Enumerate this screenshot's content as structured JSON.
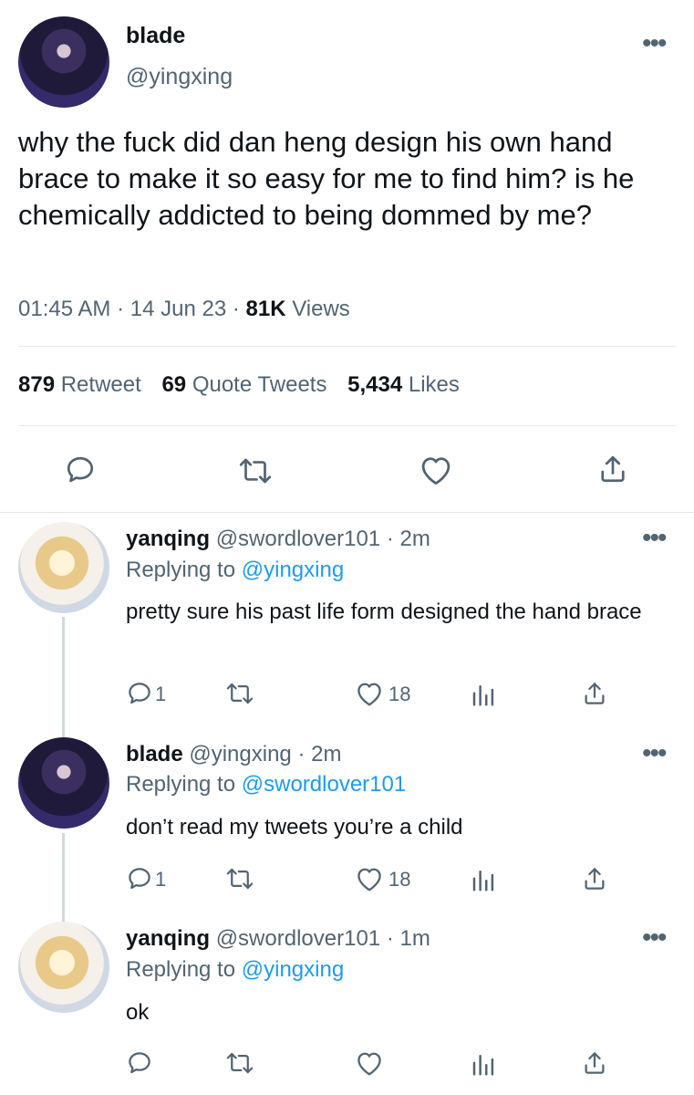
{
  "main_tweet": {
    "display_name": "blade",
    "handle": "@yingxing",
    "text": "why the fuck did dan heng design his own hand brace to make it so easy for me to find him? is he chemically addicted to being dommed by me?",
    "time": "01:45 AM",
    "date": "14 Jun 23",
    "views_count": "81K",
    "views_label": "Views",
    "sep": "·",
    "retweets_count": "879",
    "retweets_label": "Retweet",
    "quotes_count": "69",
    "quotes_label": "Quote Tweets",
    "likes_count": "5,434",
    "likes_label": "Likes"
  },
  "replies": [
    {
      "display_name": "yanqing",
      "handle": "@swordlover101",
      "age": "· 2m",
      "replying_label": "Replying to",
      "replying_to": "@yingxing",
      "text": "pretty sure his past life form designed the hand brace",
      "reply_count": "1",
      "like_count": "18"
    },
    {
      "display_name": "blade",
      "handle": "@yingxing",
      "age": "· 2m",
      "replying_label": "Replying to",
      "replying_to": "@swordlover101",
      "text": "don’t read my tweets you’re a child",
      "reply_count": "1",
      "like_count": "18"
    },
    {
      "display_name": "yanqing",
      "handle": "@swordlover101",
      "age": "· 1m",
      "replying_label": "Replying to",
      "replying_to": "@yingxing",
      "text": "ok",
      "reply_count": "",
      "like_count": ""
    }
  ],
  "icons": {
    "reply": "comment-bubble-icon",
    "retweet": "retweet-icon",
    "like": "heart-icon",
    "share": "share-icon",
    "analytics": "analytics-icon",
    "more": "more-dots-icon"
  },
  "colors": {
    "text": "#0f1419",
    "secondary": "#536471",
    "link": "#1d9bf0",
    "divider": "#e6e9ec",
    "thread_line": "#cfd9de"
  }
}
